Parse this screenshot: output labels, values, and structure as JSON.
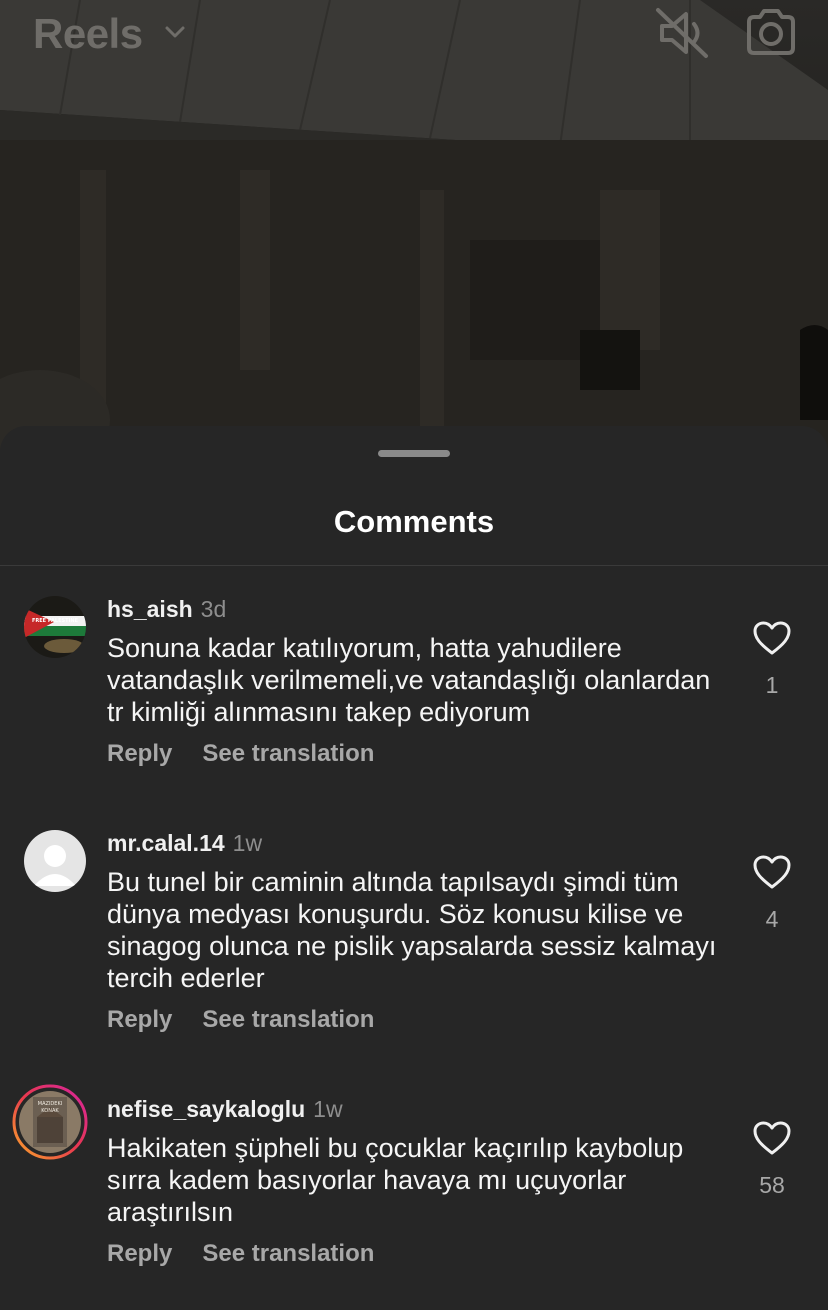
{
  "header": {
    "title": "Reels",
    "mute_icon": "speaker-muted-icon",
    "camera_icon": "camera-icon"
  },
  "sheet": {
    "title": "Comments"
  },
  "comments": [
    {
      "username": "hs_aish",
      "time": "3d",
      "text": "Sonuna kadar katılıyorum, hatta yahudilere vatandaşlık verilmemeli,ve vatandaşlığı olanlardan tr kimliği alınmasını takep ediyorum",
      "likes": "1",
      "reply_label": "Reply",
      "translate_label": "See translation",
      "avatar_text": "FREE PALESTINE"
    },
    {
      "username": "mr.calal.14",
      "time": "1w",
      "text": "Bu tunel bir caminin altında tapılsaydı şimdi tüm dünya medyası konuşurdu. Söz konusu kilise ve sinagog olunca ne pislik yapsalarda sessiz kalmayı tercih ederler",
      "likes": "4",
      "reply_label": "Reply",
      "translate_label": "See translation"
    },
    {
      "username": "nefise_saykaloglu",
      "time": "1w",
      "text": "Hakikaten şüpheli bu çocuklar kaçırılıp kaybolup sırra kadem basıyorlar havaya mı uçuyorlar araştırılsın",
      "likes": "58",
      "reply_label": "Reply",
      "translate_label": "See translation",
      "avatar_text_1": "MAZIDEKI",
      "avatar_text_2": "KONAK"
    }
  ],
  "colors": {
    "sheet_bg": "#262626",
    "muted_text": "#8e8e8e",
    "story_ring": [
      "#f9a72a",
      "#d6249f",
      "#e8384f"
    ]
  }
}
